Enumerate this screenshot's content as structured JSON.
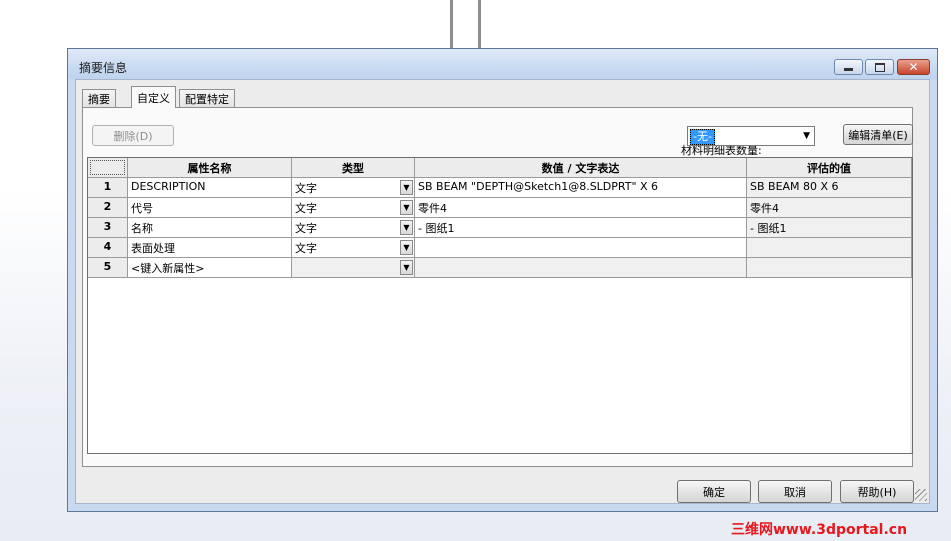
{
  "window": {
    "title": "摘要信息",
    "minimize": "minimize",
    "maximize": "maximize",
    "close": "close"
  },
  "tabs": [
    {
      "label": "摘要",
      "active": false
    },
    {
      "label": "自定义",
      "active": true
    },
    {
      "label": "配置特定",
      "active": false
    }
  ],
  "toolbar": {
    "delete_label": "删除(D)",
    "bom_label": "材料明细表数量:",
    "bom_value": "-无-",
    "edit_list_label": "编辑清单(E)"
  },
  "grid": {
    "columns": [
      "属性名称",
      "类型",
      "数值 / 文字表达",
      "评估的值"
    ],
    "rows": [
      {
        "num": "1",
        "name": "DESCRIPTION",
        "type": "文字",
        "value": "SB BEAM \"DEPTH@Sketch1@8.SLDPRT\" X 6",
        "evaluated": "SB BEAM 80 X 6"
      },
      {
        "num": "2",
        "name": "代号",
        "type": "文字",
        "value": "零件4",
        "evaluated": "零件4"
      },
      {
        "num": "3",
        "name": "名称",
        "type": "文字",
        "value": "- 图纸1",
        "evaluated": "- 图纸1"
      },
      {
        "num": "4",
        "name": "表面处理",
        "type": "文字",
        "value": "",
        "evaluated": ""
      },
      {
        "num": "5",
        "name": "<键入新属性>",
        "type": "",
        "value": "",
        "evaluated": ""
      }
    ]
  },
  "footer": {
    "ok_label": "确定",
    "cancel_label": "取消",
    "help_label": "帮助(H)"
  },
  "watermark": "三维网www.3dportal.cn",
  "colors": {
    "title_bar": "#c9dbf2",
    "selection": "#3399ff",
    "close_button": "#c9462c",
    "watermark": "#e8161f"
  }
}
